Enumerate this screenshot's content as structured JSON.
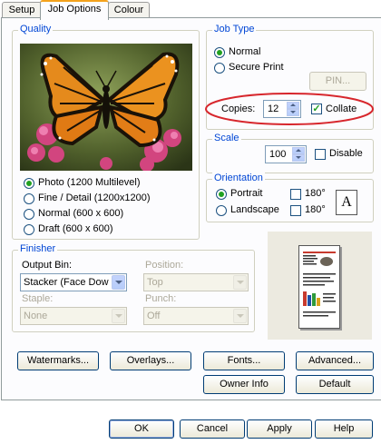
{
  "tabs": [
    {
      "label": "Setup"
    },
    {
      "label": "Job Options"
    },
    {
      "label": "Colour"
    }
  ],
  "quality": {
    "legend": "Quality",
    "options": [
      {
        "label": "Photo (1200 Multilevel)",
        "selected": true
      },
      {
        "label": "Fine / Detail (1200x1200)",
        "selected": false
      },
      {
        "label": "Normal (600 x 600)",
        "selected": false
      },
      {
        "label": "Draft (600 x 600)",
        "selected": false
      }
    ]
  },
  "job_type": {
    "legend": "Job Type",
    "normal": "Normal",
    "secure": "Secure Print",
    "pin_button": "PIN..."
  },
  "copies": {
    "label": "Copies:",
    "value": "12",
    "collate_label": "Collate",
    "collate_checked": true,
    "highlight_color": "#d7262c"
  },
  "scale": {
    "legend": "Scale",
    "value": "100",
    "disable_label": "Disable"
  },
  "orientation": {
    "legend": "Orientation",
    "portrait": "Portrait",
    "landscape": "Landscape",
    "rot180": "180°",
    "preview_letter": "A"
  },
  "finisher": {
    "legend": "Finisher",
    "output_bin_label": "Output Bin:",
    "output_bin_value": "Stacker (Face Dow",
    "position_label": "Position:",
    "position_value": "Top",
    "staple_label": "Staple:",
    "staple_value": "None",
    "punch_label": "Punch:",
    "punch_value": "Off"
  },
  "buttons": {
    "watermarks": "Watermarks...",
    "overlays": "Overlays...",
    "fonts": "Fonts...",
    "advanced": "Advanced...",
    "owner_info": "Owner Info",
    "default": "Default"
  },
  "dialog": {
    "ok": "OK",
    "cancel": "Cancel",
    "apply": "Apply",
    "help": "Help"
  }
}
